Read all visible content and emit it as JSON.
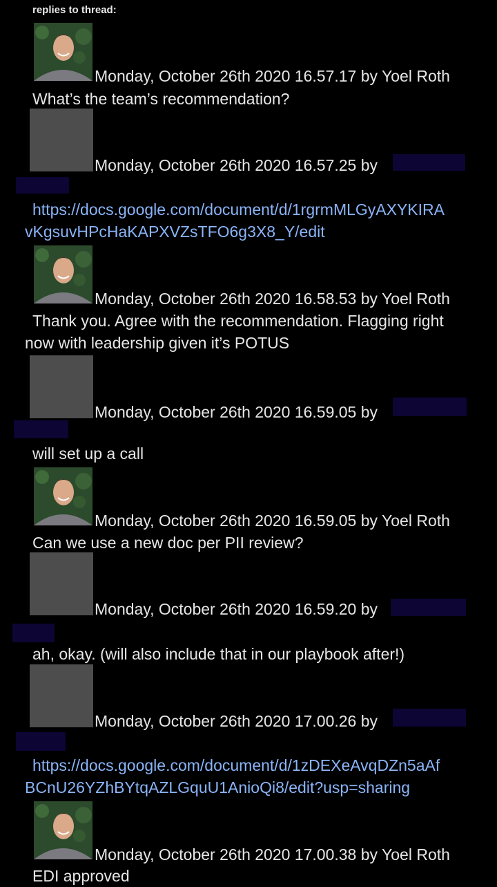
{
  "header": "replies to thread:",
  "messages": [
    {
      "avatar": "photo",
      "date": "Monday, October 26th 2020 16.57.17",
      "author": "Yoel Roth",
      "text": "What’s the team’s recommendation?",
      "type": "text"
    },
    {
      "avatar": "blank",
      "date": "Monday, October 26th 2020 16.57.25",
      "author": "",
      "line1": "https://docs.google.com/document/d/1rgrmMLGyAXYKIRA",
      "line2": "vKgsuvHPcHaKAPXVZsTFO6g3X8_Y/edit",
      "type": "link"
    },
    {
      "avatar": "photo",
      "date": "Monday, October 26th 2020 16.58.53",
      "author": "Yoel Roth",
      "line1": "Thank you. Agree with the recommendation. Flagging right",
      "line2": "now with leadership given it’s POTUS",
      "type": "text2"
    },
    {
      "avatar": "blank",
      "date": "Monday, October 26th 2020 16.59.05",
      "author": "",
      "text": "will set up a call",
      "type": "text"
    },
    {
      "avatar": "photo",
      "date": "Monday, October 26th 2020 16.59.05",
      "author": "Yoel Roth",
      "text": "Can we use a new doc per PII review?",
      "type": "text"
    },
    {
      "avatar": "blank",
      "date": "Monday, October 26th 2020 16.59.20",
      "author": "",
      "text": "ah, okay. (will also include that in our playbook after!)",
      "type": "text"
    },
    {
      "avatar": "blank",
      "date": "Monday, October 26th 2020 17.00.26",
      "author": "",
      "line1": "https://docs.google.com/document/d/1zDEXeAvqDZn5aAf",
      "line2": "BCnU26YZhBYtqAZLGquU1AnioQi8/edit?usp=sharing",
      "type": "link"
    },
    {
      "avatar": "photo",
      "date": "Monday, October 26th 2020 17.00.38",
      "author": "Yoel Roth",
      "text": "EDI approved",
      "type": "text"
    }
  ],
  "by_word": "by",
  "colors": {
    "background": "#000000",
    "text": "#e6e6e6",
    "link": "#8ab4f8",
    "redaction": "#0d0533",
    "blank_avatar": "#4d4d4d"
  }
}
